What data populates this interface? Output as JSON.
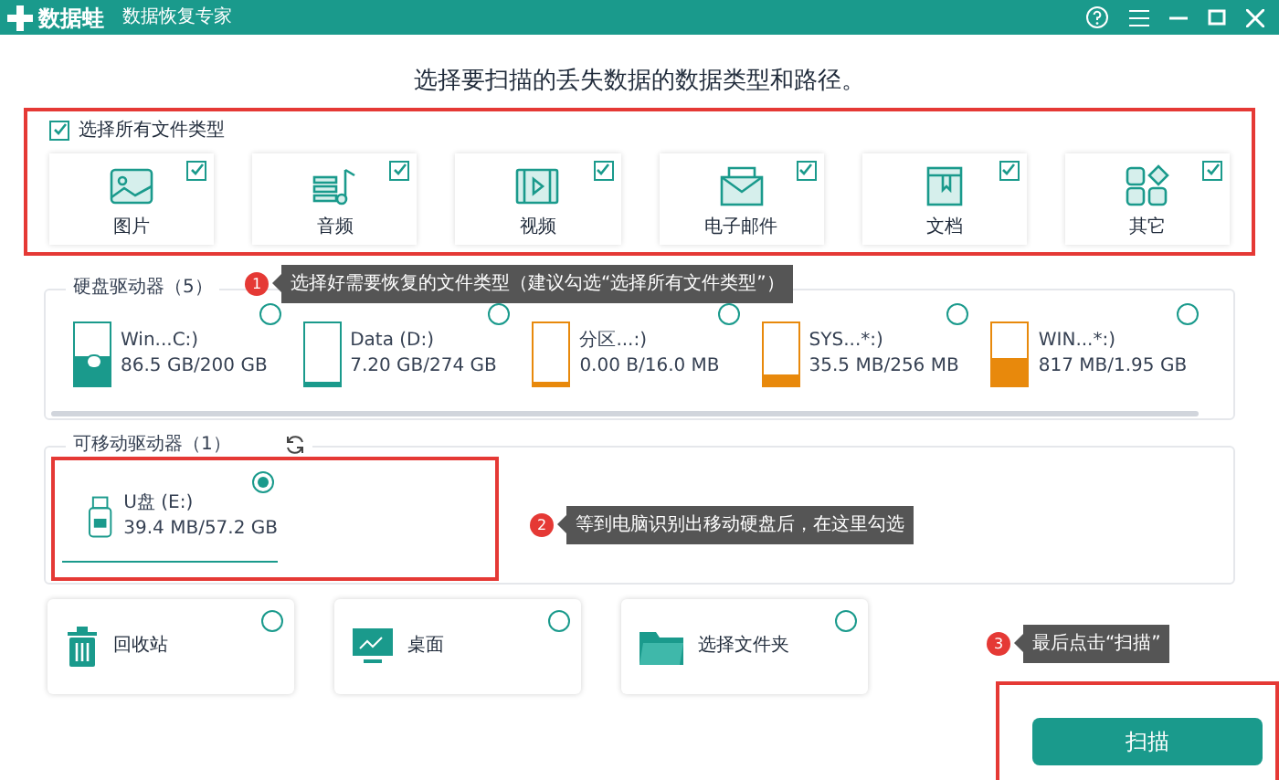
{
  "window": {
    "logo": "数据蛙",
    "subtitle": "数据恢复专家"
  },
  "heading": "选择要扫描的丢失数据的数据类型和路径。",
  "select_all": {
    "label": "选择所有文件类型",
    "checked": true
  },
  "file_types": [
    {
      "kind": "image",
      "label": "图片",
      "checked": true
    },
    {
      "kind": "audio",
      "label": "音频",
      "checked": true
    },
    {
      "kind": "video",
      "label": "视频",
      "checked": true
    },
    {
      "kind": "email",
      "label": "电子邮件",
      "checked": true
    },
    {
      "kind": "document",
      "label": "文档",
      "checked": true
    },
    {
      "kind": "other",
      "label": "其它",
      "checked": true
    }
  ],
  "hard_drives": {
    "title": "硬盘驱动器（5）",
    "drives": [
      {
        "name": "Win...C:)",
        "usage": "86.5 GB/200 GB",
        "level": 0.45,
        "color": "#1a9a8c",
        "system": true,
        "selected": false
      },
      {
        "name": "Data (D:)",
        "usage": "7.20 GB/274 GB",
        "level": 0.03,
        "color": "#1a9a8c",
        "system": false,
        "selected": false
      },
      {
        "name": "分区...:)",
        "usage": "0.00  B/16.0 MB",
        "level": 0,
        "color": "#e8890c",
        "system": false,
        "selected": false
      },
      {
        "name": "SYS...*:)",
        "usage": "35.5 MB/256 MB",
        "level": 0.15,
        "color": "#e8890c",
        "system": false,
        "selected": false
      },
      {
        "name": "WIN...*:)",
        "usage": "817 MB/1.95 GB",
        "level": 0.42,
        "color": "#e8890c",
        "system": false,
        "selected": false
      }
    ]
  },
  "removable_drives": {
    "title": "可移动驱动器（1）",
    "drives": [
      {
        "name": "U盘 (E:)",
        "usage": "39.4 MB/57.2 GB",
        "selected": true
      }
    ]
  },
  "locations": [
    {
      "kind": "recycle",
      "label": "回收站",
      "selected": false
    },
    {
      "kind": "desktop",
      "label": "桌面",
      "selected": false
    },
    {
      "kind": "folder",
      "label": "选择文件夹",
      "selected": false
    }
  ],
  "tips": [
    {
      "number": "1",
      "text": "选择好需要恢复的文件类型（建议勾选“选择所有文件类型”）"
    },
    {
      "number": "2",
      "text": "等到电脑识别出移动硬盘后，在这里勾选"
    },
    {
      "number": "3",
      "text": "最后点击“扫描”"
    }
  ],
  "scan_button": "扫描"
}
